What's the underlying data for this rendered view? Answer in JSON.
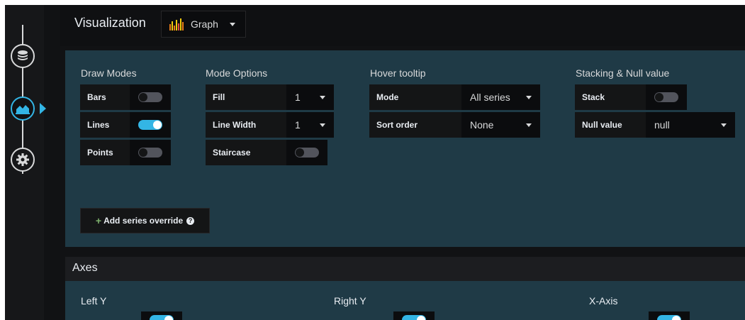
{
  "header": {
    "title": "Visualization",
    "viz_select": "Graph",
    "viz_icon": "bar-chart-icon"
  },
  "rail": {
    "items": [
      "database-icon",
      "chart-area-icon",
      "settings-gear-icon"
    ]
  },
  "draw_modes": {
    "title": "Draw Modes",
    "items": [
      {
        "label": "Bars",
        "on": false
      },
      {
        "label": "Lines",
        "on": true
      },
      {
        "label": "Points",
        "on": false
      }
    ]
  },
  "mode_options": {
    "title": "Mode Options",
    "fill": {
      "label": "Fill",
      "value": "1"
    },
    "line_width": {
      "label": "Line Width",
      "value": "1"
    },
    "staircase": {
      "label": "Staircase",
      "on": false
    }
  },
  "hover_tooltip": {
    "title": "Hover tooltip",
    "mode": {
      "label": "Mode",
      "value": "All series"
    },
    "sort_order": {
      "label": "Sort order",
      "value": "None"
    }
  },
  "stacking": {
    "title": "Stacking & Null value",
    "stack": {
      "label": "Stack",
      "on": false
    },
    "null_value": {
      "label": "Null value",
      "value": "null"
    }
  },
  "override": {
    "label": "Add series override"
  },
  "axes": {
    "title": "Axes",
    "left_y": "Left Y",
    "right_y": "Right Y",
    "x_axis": "X-Axis"
  },
  "colors": {
    "accent": "#33b5e5",
    "panel": "#1f3a46",
    "background": "#111214"
  }
}
